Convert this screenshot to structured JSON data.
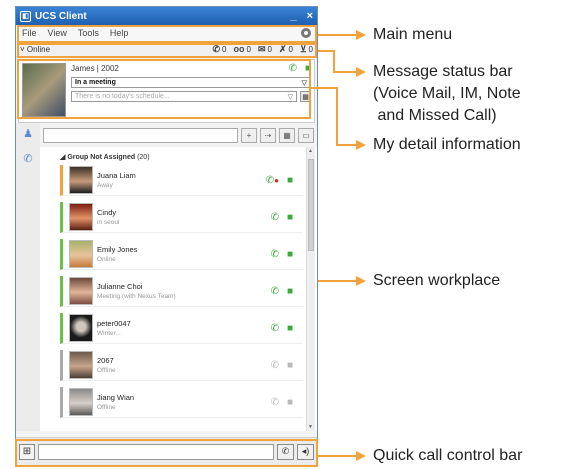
{
  "window": {
    "title": "UCS Client",
    "minimize": "_",
    "close": "×"
  },
  "menu": [
    "File",
    "View",
    "Tools",
    "Help"
  ],
  "presence": "˅ Online",
  "counters": [
    {
      "icon": "voicemail-icon",
      "glyph": "✆",
      "value": "0"
    },
    {
      "icon": "im-icon",
      "glyph": "oo",
      "value": "0"
    },
    {
      "icon": "note-icon",
      "glyph": "✉",
      "value": "0"
    },
    {
      "icon": "missed-call-icon",
      "glyph": "✗",
      "value": "0"
    },
    {
      "icon": "call-log-icon",
      "glyph": "⊻",
      "value": "0"
    }
  ],
  "me": {
    "name": "James | 2002",
    "status": "In a meeting",
    "schedule_placeholder": "There is no today's schedule..."
  },
  "group": {
    "name": "Group Not Assigned",
    "count": "(20)"
  },
  "contacts": [
    {
      "name": "Juana Liam",
      "status": "Away",
      "state": "away"
    },
    {
      "name": "Cindy",
      "status": "in seoul",
      "state": "online"
    },
    {
      "name": "Emily Jones",
      "status": "Online",
      "state": "online"
    },
    {
      "name": "Julianne Choi",
      "status": "Meeting (with Nexus Team)",
      "state": "online"
    },
    {
      "name": "peter0047",
      "status": "Winter...",
      "state": "online"
    },
    {
      "name": "2067",
      "status": "Offline",
      "state": "offline"
    },
    {
      "name": "Jiang Wian",
      "status": "Offline",
      "state": "offline"
    }
  ],
  "callouts": {
    "main_menu": "Main menu",
    "status_bar_1": "Message status bar",
    "status_bar_2": "(Voice Mail, IM, Note",
    "status_bar_3": " and Missed Call)",
    "detail": "My detail information",
    "workplace": "Screen workplace",
    "quickcall": "Quick call control bar"
  },
  "accent": "#f2a23a"
}
